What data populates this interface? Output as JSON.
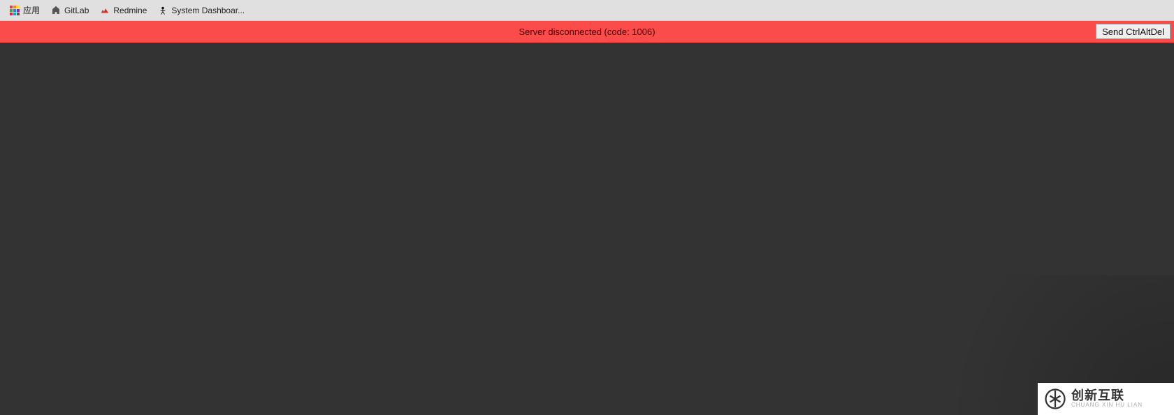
{
  "bookmarks": {
    "apps_label": "应用",
    "items": [
      {
        "label": "GitLab"
      },
      {
        "label": "Redmine"
      },
      {
        "label": "System Dashboar..."
      }
    ]
  },
  "status": {
    "message": "Server disconnected (code: 1006)",
    "button_label": "Send CtrlAltDel"
  },
  "watermark": {
    "brand_cn": "创新互联",
    "brand_en": "CHUANG XIN HU LIAN"
  },
  "colors": {
    "status_bg": "#fb4c4c",
    "view_bg": "#333333",
    "bookmark_bg": "#e0e0e0"
  }
}
